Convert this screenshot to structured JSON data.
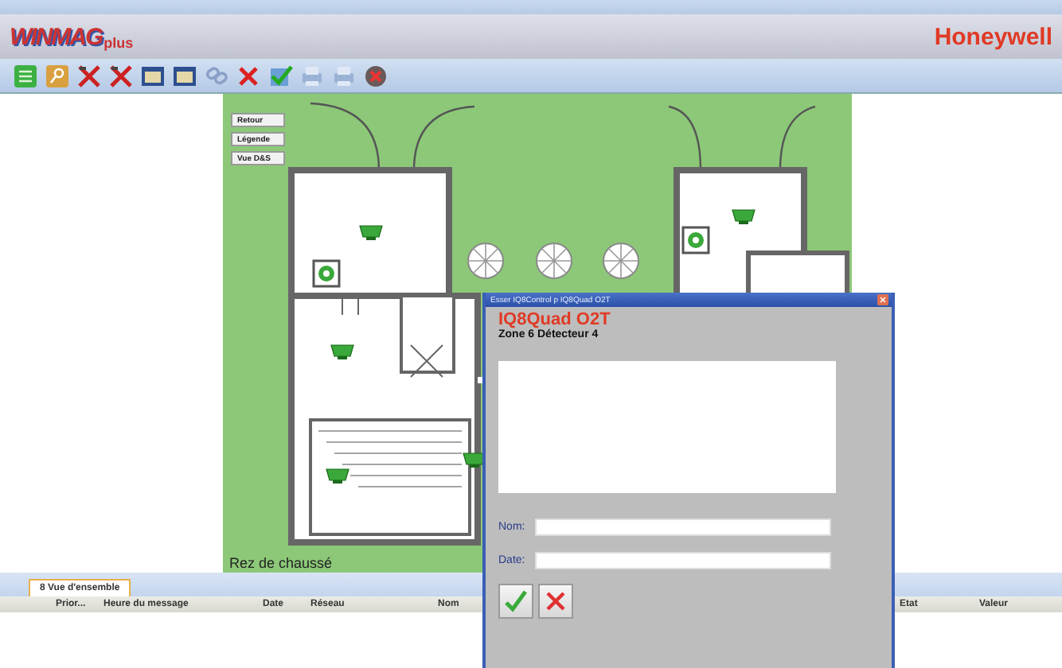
{
  "logo": {
    "name": "WINMAG",
    "suffix": "plus"
  },
  "brand": "Honeywell",
  "plan": {
    "buttons": [
      "Retour",
      "Légende",
      "Vue D&S"
    ],
    "floor_label": "Rez de chaussé"
  },
  "bottom_panel": {
    "tab": {
      "label": "8 Vue d'ensemble",
      "selected": true
    },
    "columns": [
      "Prior...",
      "Heure du message",
      "Date",
      "Réseau",
      "Nom",
      "Etat",
      "Valeur"
    ]
  },
  "dialog": {
    "title": "Esser IQ8Control p  IQ8Quad O2T",
    "device": "IQ8Quad O2T",
    "zone": "Zone 6 Détecteur 4",
    "fields": [
      {
        "label": "Nom:"
      },
      {
        "label": "Date:"
      }
    ]
  }
}
